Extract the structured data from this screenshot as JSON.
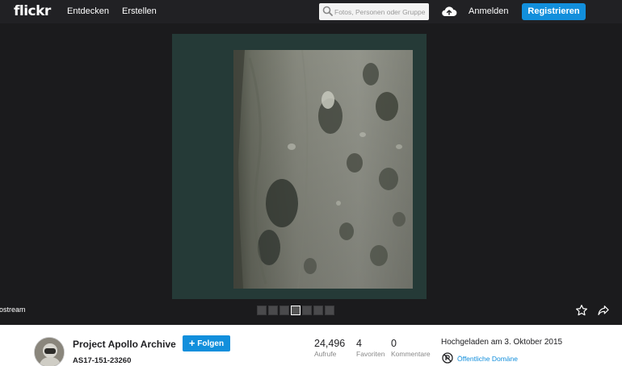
{
  "brand": {
    "logo_text": "flickr"
  },
  "nav": {
    "explore": "Entdecken",
    "create": "Erstellen",
    "search_placeholder": "Fotos, Personen oder Gruppe",
    "login": "Anmelden",
    "signup": "Registrieren"
  },
  "viewer": {
    "stream_label": "ostream",
    "thumb_count": 7,
    "active_thumb_index": 3
  },
  "info": {
    "owner": "Project Apollo Archive",
    "follow_label": "Folgen",
    "photo_title": "AS17-151-23260",
    "stats": {
      "views": {
        "value": "24,496",
        "label": "Aufrufe"
      },
      "favs": {
        "value": "4",
        "label": "Favoriten"
      },
      "comments": {
        "value": "0",
        "label": "Kommentare"
      }
    },
    "uploaded": "Hochgeladen am 3. Oktober 2015",
    "license": "Öffentliche Domäne"
  },
  "colors": {
    "nav_bg": "#212124",
    "viewer_bg": "#1b1b1d",
    "accent": "#128fdc",
    "photo_border": "#253a37"
  },
  "icons": {
    "search": "search-icon",
    "upload": "cloud-upload-icon",
    "favorite": "star-icon",
    "share": "share-arrow-icon",
    "license": "public-domain-icon"
  }
}
